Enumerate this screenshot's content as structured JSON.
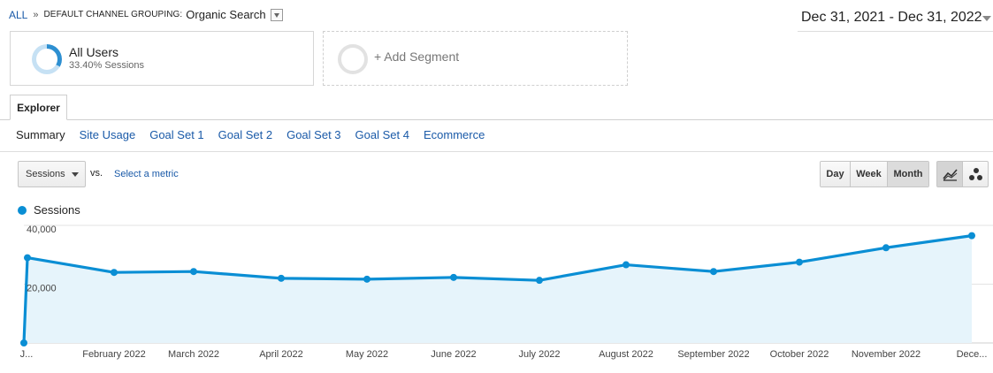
{
  "breadcrumb": {
    "all": "ALL",
    "separator": "»",
    "dimension": "DEFAULT CHANNEL GROUPING:",
    "value": "Organic Search"
  },
  "date_range": "Dec 31, 2021 - Dec 31, 2022",
  "segments": {
    "primary": {
      "title": "All Users",
      "subtitle": "33.40% Sessions",
      "share_percent": 33.4
    },
    "add_label": "+ Add Segment"
  },
  "tabs": {
    "explorer": "Explorer"
  },
  "subtabs": [
    "Summary",
    "Site Usage",
    "Goal Set 1",
    "Goal Set 2",
    "Goal Set 3",
    "Goal Set 4",
    "Ecommerce"
  ],
  "controls": {
    "metric": "Sessions",
    "vs": "vs.",
    "select_metric": "Select a metric",
    "granularity": {
      "day": "Day",
      "week": "Week",
      "month": "Month",
      "selected": "Month"
    },
    "view": {
      "line": "line-chart-icon",
      "motion": "motion-chart-icon",
      "selected": "line"
    }
  },
  "colors": {
    "accent": "#0a8ed4",
    "fill": "#e6f4fb",
    "link": "#1a5aa8"
  },
  "chart_data": {
    "type": "area",
    "series": [
      {
        "name": "Sessions",
        "x": [
          "Dec 31, 2021",
          "Jan 2022",
          "Feb 2022",
          "Mar 2022",
          "Apr 2022",
          "May 2022",
          "Jun 2022",
          "Jul 2022",
          "Aug 2022",
          "Sep 2022",
          "Oct 2022",
          "Nov 2022",
          "Dec 2022"
        ],
        "values": [
          0,
          29000,
          24000,
          24300,
          22000,
          21700,
          22300,
          21300,
          26600,
          24300,
          27500,
          32400,
          36500
        ]
      }
    ],
    "x_tick_labels": [
      "J...",
      "February 2022",
      "March 2022",
      "April 2022",
      "May 2022",
      "June 2022",
      "July 2022",
      "August 2022",
      "September 2022",
      "October 2022",
      "November 2022",
      "Dece..."
    ],
    "y_tick_labels": [
      "40,000",
      "20,000"
    ],
    "y_ticks": [
      40000,
      20000
    ],
    "ylim": [
      0,
      40000
    ],
    "grid": true
  }
}
